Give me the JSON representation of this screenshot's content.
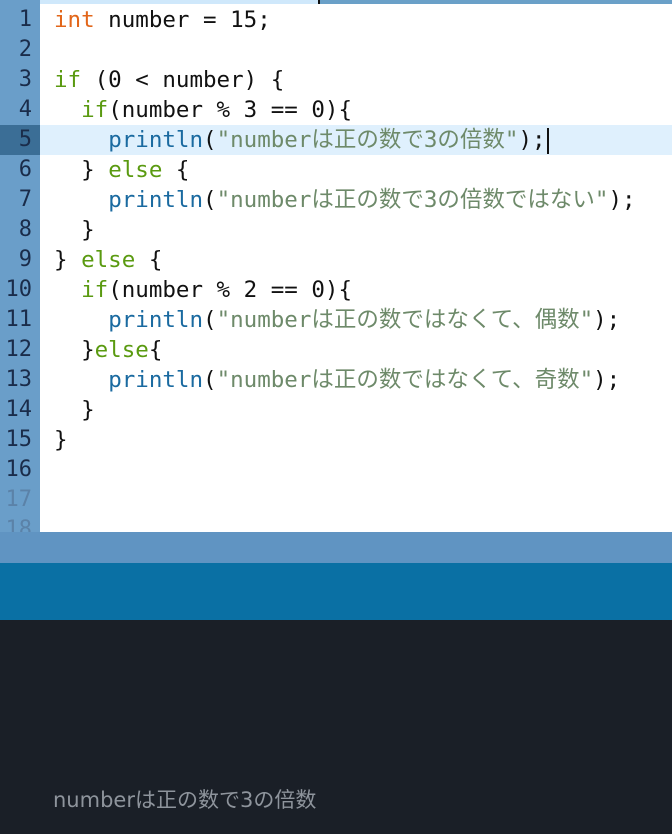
{
  "editor": {
    "active_line": 5,
    "lines": [
      {
        "num": "1",
        "tokens": [
          {
            "t": "int",
            "c": "kw-type"
          },
          {
            "t": " number = 15;",
            "c": ""
          }
        ]
      },
      {
        "num": "2",
        "tokens": []
      },
      {
        "num": "3",
        "tokens": [
          {
            "t": "if",
            "c": "kw"
          },
          {
            "t": " (0 < number) {",
            "c": ""
          }
        ]
      },
      {
        "num": "4",
        "tokens": [
          {
            "t": "  ",
            "c": ""
          },
          {
            "t": "if",
            "c": "kw"
          },
          {
            "t": "(number % 3 == 0){",
            "c": ""
          }
        ]
      },
      {
        "num": "5",
        "tokens": [
          {
            "t": "    ",
            "c": ""
          },
          {
            "t": "println",
            "c": "fn"
          },
          {
            "t": "(",
            "c": ""
          },
          {
            "t": "\"numberは正の数で3の倍数\"",
            "c": "str"
          },
          {
            "t": ");",
            "c": ""
          }
        ],
        "cursor": true
      },
      {
        "num": "6",
        "tokens": [
          {
            "t": "  } ",
            "c": ""
          },
          {
            "t": "else",
            "c": "kw"
          },
          {
            "t": " {",
            "c": ""
          }
        ]
      },
      {
        "num": "7",
        "tokens": [
          {
            "t": "    ",
            "c": ""
          },
          {
            "t": "println",
            "c": "fn"
          },
          {
            "t": "(",
            "c": ""
          },
          {
            "t": "\"numberは正の数で3の倍数ではない\"",
            "c": "str"
          },
          {
            "t": ");",
            "c": ""
          }
        ]
      },
      {
        "num": "8",
        "tokens": [
          {
            "t": "  }",
            "c": ""
          }
        ]
      },
      {
        "num": "9",
        "tokens": [
          {
            "t": "} ",
            "c": ""
          },
          {
            "t": "else",
            "c": "kw"
          },
          {
            "t": " {",
            "c": ""
          }
        ]
      },
      {
        "num": "10",
        "tokens": [
          {
            "t": "  ",
            "c": ""
          },
          {
            "t": "if",
            "c": "kw"
          },
          {
            "t": "(number % 2 == 0){",
            "c": ""
          }
        ]
      },
      {
        "num": "11",
        "tokens": [
          {
            "t": "    ",
            "c": ""
          },
          {
            "t": "println",
            "c": "fn"
          },
          {
            "t": "(",
            "c": ""
          },
          {
            "t": "\"numberは正の数ではなくて、偶数\"",
            "c": "str"
          },
          {
            "t": ");",
            "c": ""
          }
        ]
      },
      {
        "num": "12",
        "tokens": [
          {
            "t": "  }",
            "c": ""
          },
          {
            "t": "else",
            "c": "kw"
          },
          {
            "t": "{",
            "c": ""
          }
        ]
      },
      {
        "num": "13",
        "tokens": [
          {
            "t": "    ",
            "c": ""
          },
          {
            "t": "println",
            "c": "fn"
          },
          {
            "t": "(",
            "c": ""
          },
          {
            "t": "\"numberは正の数ではなくて、奇数\"",
            "c": "str"
          },
          {
            "t": ");",
            "c": ""
          }
        ]
      },
      {
        "num": "14",
        "tokens": [
          {
            "t": "  }",
            "c": ""
          }
        ]
      },
      {
        "num": "15",
        "tokens": [
          {
            "t": "}",
            "c": ""
          }
        ]
      },
      {
        "num": "16",
        "tokens": []
      },
      {
        "num": "17",
        "tokens": [],
        "faded": true
      },
      {
        "num": "18",
        "tokens": [],
        "faded": true
      }
    ]
  },
  "console": {
    "output": "numberは正の数で3の倍数"
  },
  "colors": {
    "gutter": "#6a9ec9",
    "active_line_bg": "#dff0fd",
    "active_gutter": "#3b6e96",
    "keyword_type": "#e2661a",
    "keyword": "#5a9a10",
    "function": "#1a6aa0",
    "string": "#6e8a6a",
    "status_bar": "#6094c2",
    "toolbar": "#0a70a4",
    "console_bg": "#1a1f27"
  }
}
